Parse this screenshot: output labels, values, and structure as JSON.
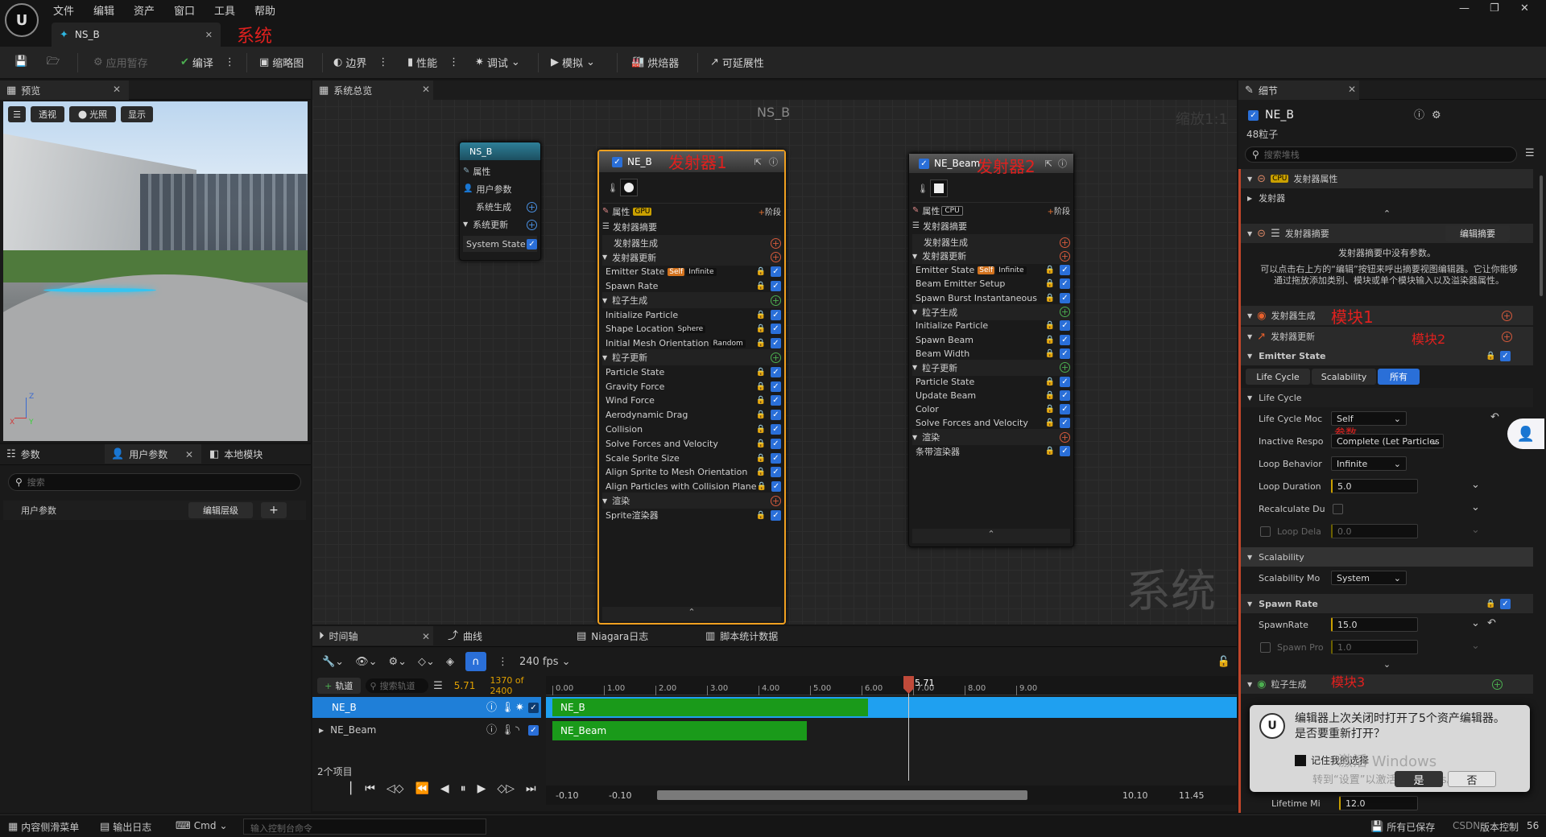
{
  "menu": [
    "文件",
    "编辑",
    "资产",
    "窗口",
    "工具",
    "帮助"
  ],
  "asset_tab": {
    "label": "NS_B"
  },
  "annotations": {
    "system": "系统",
    "emitter1": "发射器1",
    "emitter2": "发射器2",
    "module1": "模块1",
    "module2": "模块2",
    "module3": "模块3",
    "params": "参数",
    "watermark": "系统"
  },
  "toolbar": {
    "apply": "应用暂存",
    "compile": "编译",
    "thumbnail": "缩略图",
    "bounds": "边界",
    "performance": "性能",
    "debug": "调试",
    "simulate": "模拟",
    "baker": "烘焙器",
    "scalability": "可延展性"
  },
  "preview": {
    "tab": "预览",
    "perspective": "透视",
    "lit": "光照",
    "show": "显示",
    "axis_x": "X",
    "axis_z": "Z",
    "axis_y": "Y"
  },
  "params_panel": {
    "tabs": [
      "参数",
      "用户参数",
      "本地模块"
    ],
    "search": "搜索",
    "user_params": "用户参数",
    "edit_hierarchy": "编辑层级",
    "add": "+"
  },
  "overview": {
    "tab": "系统总览",
    "title": "NS_B",
    "zoom": "缩放1:1"
  },
  "system_node": {
    "title": "NS_B",
    "items": [
      "属性",
      "用户参数",
      "系统生成",
      "系统更新",
      "System State"
    ]
  },
  "emitter1": {
    "title": "NE_B",
    "props": "属性",
    "gpu": "GPU",
    "stage": "阶段",
    "summary": "发射器摘要",
    "items": [
      {
        "t": "发射器生成",
        "k": "cat"
      },
      {
        "t": "发射器更新",
        "k": "cat"
      },
      {
        "t": "Emitter State",
        "k": "mod",
        "tag": "Self",
        "tag2": "Infinite"
      },
      {
        "t": "Spawn Rate",
        "k": "mod"
      },
      {
        "t": "粒子生成",
        "k": "cat"
      },
      {
        "t": "Initialize Particle",
        "k": "mod"
      },
      {
        "t": "Shape Location",
        "k": "mod",
        "tag2": "Sphere"
      },
      {
        "t": "Initial Mesh Orientation",
        "k": "mod",
        "tag2": "Random"
      },
      {
        "t": "粒子更新",
        "k": "cat"
      },
      {
        "t": "Particle State",
        "k": "mod"
      },
      {
        "t": "Gravity Force",
        "k": "mod"
      },
      {
        "t": "Wind Force",
        "k": "mod"
      },
      {
        "t": "Aerodynamic Drag",
        "k": "mod"
      },
      {
        "t": "Collision",
        "k": "mod"
      },
      {
        "t": "Solve Forces and Velocity",
        "k": "mod"
      },
      {
        "t": "Scale Sprite Size",
        "k": "mod"
      },
      {
        "t": "Align Sprite to Mesh Orientation",
        "k": "mod"
      },
      {
        "t": "Align Particles with Collision Plane",
        "k": "mod"
      },
      {
        "t": "渲染",
        "k": "cat"
      },
      {
        "t": "Sprite渲染器",
        "k": "mod"
      }
    ]
  },
  "emitter2": {
    "title": "NE_Beam",
    "props": "属性",
    "cpu": "CPU",
    "stage": "阶段",
    "summary": "发射器摘要",
    "items": [
      {
        "t": "发射器生成",
        "k": "cat"
      },
      {
        "t": "发射器更新",
        "k": "cat"
      },
      {
        "t": "Emitter State",
        "k": "mod",
        "tag": "Self",
        "tag2": "Infinite"
      },
      {
        "t": "Beam Emitter Setup",
        "k": "mod"
      },
      {
        "t": "Spawn Burst Instantaneous",
        "k": "mod"
      },
      {
        "t": "粒子生成",
        "k": "cat"
      },
      {
        "t": "Initialize Particle",
        "k": "mod"
      },
      {
        "t": "Spawn Beam",
        "k": "mod"
      },
      {
        "t": "Beam Width",
        "k": "mod"
      },
      {
        "t": "粒子更新",
        "k": "cat"
      },
      {
        "t": "Particle State",
        "k": "mod"
      },
      {
        "t": "Update Beam",
        "k": "mod"
      },
      {
        "t": "Color",
        "k": "mod"
      },
      {
        "t": "Solve Forces and Velocity",
        "k": "mod"
      },
      {
        "t": "渲染",
        "k": "cat"
      },
      {
        "t": "条带渲染器",
        "k": "mod"
      }
    ]
  },
  "details": {
    "tab": "细节",
    "name": "NE_B",
    "count": "48粒子",
    "search": "搜索堆栈",
    "emitter_props": "发射器属性",
    "cpu": "CPU",
    "emitter": "发射器",
    "summary": "发射器摘要",
    "edit_summary": "编辑摘要",
    "no_params": "发射器摘要中没有参数。",
    "hint": "可以点击右上方的“编辑”按钮来呼出摘要视图编辑器。它让你能够通过拖放添加类别、模块或单个模块输入以及溢染器属性。",
    "emitter_spawn": "发射器生成",
    "emitter_update": "发射器更新",
    "emitter_state": "Emitter State",
    "filters": [
      "Life Cycle",
      "Scalability",
      "所有"
    ],
    "lifecycle": "Life Cycle",
    "lcm": "Life Cycle Moc",
    "lcm_v": "Self",
    "inactive": "Inactive Respo",
    "inactive_v": "Complete (Let Particles",
    "loop_b": "Loop Behavior",
    "loop_b_v": "Infinite",
    "loop_d": "Loop Duration",
    "loop_d_v": "5.0",
    "recalc": "Recalculate Du",
    "loop_delay": "Loop Dela",
    "loop_delay_v": "0.0",
    "scalability": "Scalability",
    "scal_mode": "Scalability Mo",
    "scal_mode_v": "System",
    "spawn_rate": "Spawn Rate",
    "spawnrate": "SpawnRate",
    "spawnrate_v": "15.0",
    "spawn_pr": "Spawn Pro",
    "spawn_pr_v": "1.0",
    "particle_spawn": "粒子生成",
    "lifetime": "Lifetime Mi",
    "lifetime_v": "12.0"
  },
  "dialog": {
    "text": "编辑器上次关闭时打开了5个资产编辑器。是否要重新打开？",
    "remember": "记住我的选择",
    "yes": "是",
    "no": "否",
    "activate1": "激活 Windows",
    "activate2": "转到“设置”以激活 Windows。"
  },
  "timeline": {
    "tabs": [
      "时间轴",
      "曲线",
      "Niagara日志",
      "脚本统计数据"
    ],
    "fps": "240 fps",
    "add_track": "轨道",
    "search": "搜索轨道",
    "current": "5.71",
    "frames": "1370 of 2400",
    "tracks": [
      "NE_B",
      "NE_Beam"
    ],
    "count": "2个项目",
    "ruler": [
      "0.00",
      "1.00",
      "2.00",
      "3.00",
      "4.00",
      "5.00",
      "6.00",
      "7.00",
      "8.00",
      "9.00"
    ],
    "playhead": "5.71",
    "range_left": "-0.10",
    "range_left2": "-0.10",
    "range_r1": "10.10",
    "range_r2": "11.45"
  },
  "statusbar": {
    "content": "内容侧滑菜单",
    "output": "输出日志",
    "cmd": "Cmd",
    "console": "输入控制台命令",
    "saved": "所有已保存",
    "source": "版本控制",
    "csdn": "CSDN",
    "suffix": "56"
  },
  "colors": {
    "accent": "#2a6fd8",
    "selected_orange": "#f0a020",
    "track_green": "#1a9a1a",
    "track_blue": "#1fa0f0"
  }
}
